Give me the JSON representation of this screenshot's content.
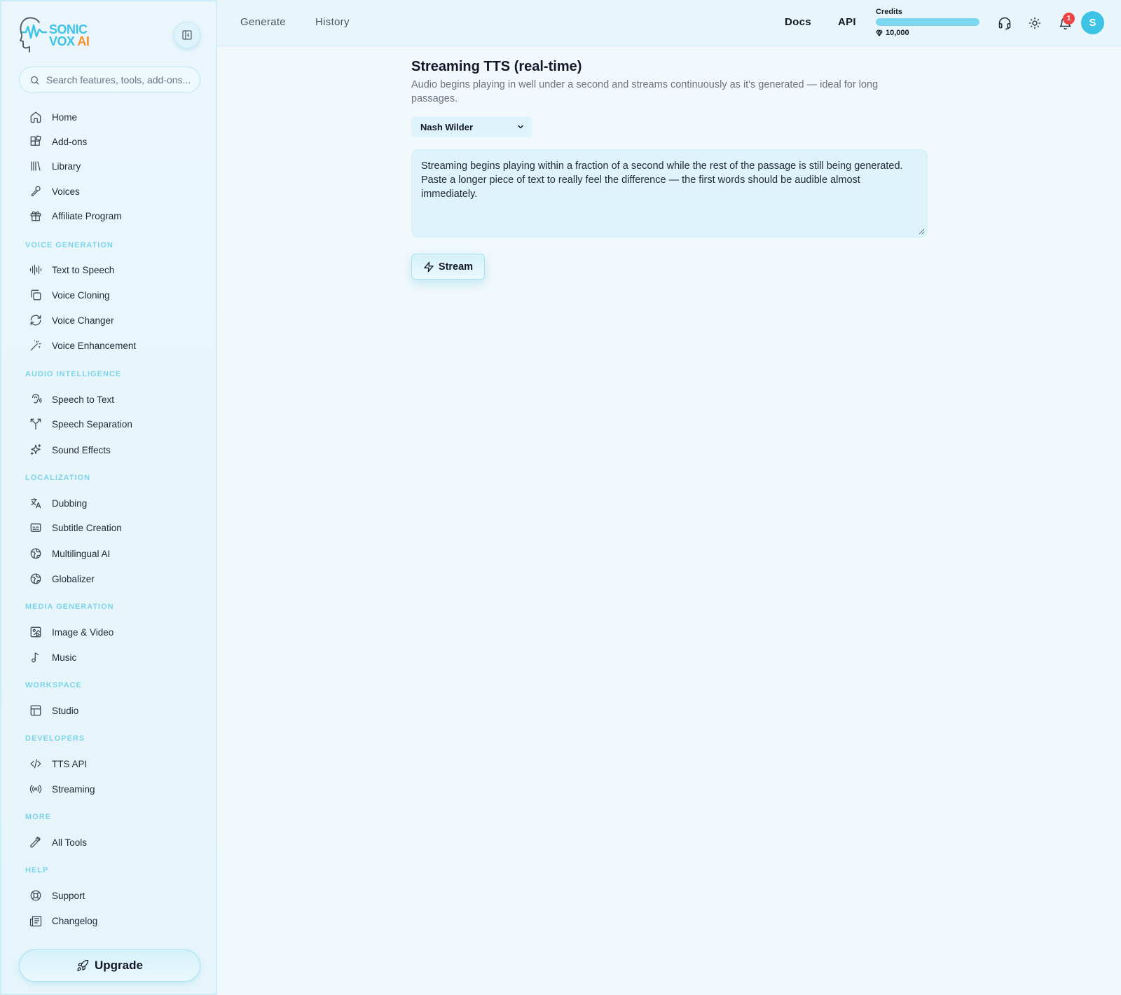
{
  "brand": {
    "line1": "SONIC",
    "line2": "VOX",
    "ai": "AI"
  },
  "search": {
    "placeholder": "Search features, tools, add-ons..."
  },
  "sidebar": {
    "top_items": [
      {
        "label": "Home",
        "icon": "home-icon"
      },
      {
        "label": "Add-ons",
        "icon": "addons-icon"
      },
      {
        "label": "Library",
        "icon": "library-icon"
      },
      {
        "label": "Voices",
        "icon": "voices-icon"
      },
      {
        "label": "Affiliate Program",
        "icon": "gift-icon"
      }
    ],
    "sections": [
      {
        "title": "VOICE GENERATION",
        "items": [
          {
            "label": "Text to Speech",
            "icon": "audio-lines-icon"
          },
          {
            "label": "Voice Cloning",
            "icon": "copy-icon"
          },
          {
            "label": "Voice Changer",
            "icon": "refresh-icon"
          },
          {
            "label": "Voice Enhancement",
            "icon": "wand-icon"
          }
        ]
      },
      {
        "title": "AUDIO INTELLIGENCE",
        "items": [
          {
            "label": "Speech to Text",
            "icon": "ear-icon"
          },
          {
            "label": "Speech Separation",
            "icon": "split-icon"
          },
          {
            "label": "Sound Effects",
            "icon": "sparkles-icon"
          }
        ]
      },
      {
        "title": "LOCALIZATION",
        "items": [
          {
            "label": "Dubbing",
            "icon": "translate-icon"
          },
          {
            "label": "Subtitle Creation",
            "icon": "captions-icon"
          },
          {
            "label": "Multilingual AI",
            "icon": "globe-icon"
          },
          {
            "label": "Globalizer",
            "icon": "globe-icon"
          }
        ]
      },
      {
        "title": "MEDIA GENERATION",
        "items": [
          {
            "label": "Image & Video",
            "icon": "image-play-icon"
          },
          {
            "label": "Music",
            "icon": "music-icon"
          }
        ]
      },
      {
        "title": "WORKSPACE",
        "items": [
          {
            "label": "Studio",
            "icon": "layout-icon"
          }
        ]
      },
      {
        "title": "DEVELOPERS",
        "items": [
          {
            "label": "TTS API",
            "icon": "code-icon"
          },
          {
            "label": "Streaming",
            "icon": "radio-icon"
          }
        ]
      },
      {
        "title": "MORE",
        "items": [
          {
            "label": "All Tools",
            "icon": "wrench-icon"
          }
        ]
      },
      {
        "title": "HELP",
        "items": [
          {
            "label": "Support",
            "icon": "lifebuoy-icon"
          },
          {
            "label": "Changelog",
            "icon": "newspaper-icon"
          }
        ]
      }
    ],
    "upgrade_label": "Upgrade"
  },
  "topbar": {
    "tabs": [
      "Generate",
      "History"
    ],
    "links": [
      "Docs",
      "API"
    ],
    "credits_label": "Credits",
    "credits_value": "10,000",
    "credits_fill_fraction": 1.0,
    "notification_count": "1",
    "avatar_initial": "S"
  },
  "main": {
    "title": "Streaming TTS (real-time)",
    "description": "Audio begins playing in well under a second and streams continuously as it's generated — ideal for long passages.",
    "voice_selected": "Nash Wilder",
    "text": "Streaming begins playing within a fraction of a second while the rest of the passage is still being generated. Paste a longer piece of text to really feel the difference — the first words should be audible almost immediately.",
    "stream_label": "Stream"
  },
  "colors": {
    "accent": "#3cc3e6",
    "accent_orange": "#f7922a",
    "section_label": "#7dd3ea",
    "badge": "#ef4444"
  }
}
